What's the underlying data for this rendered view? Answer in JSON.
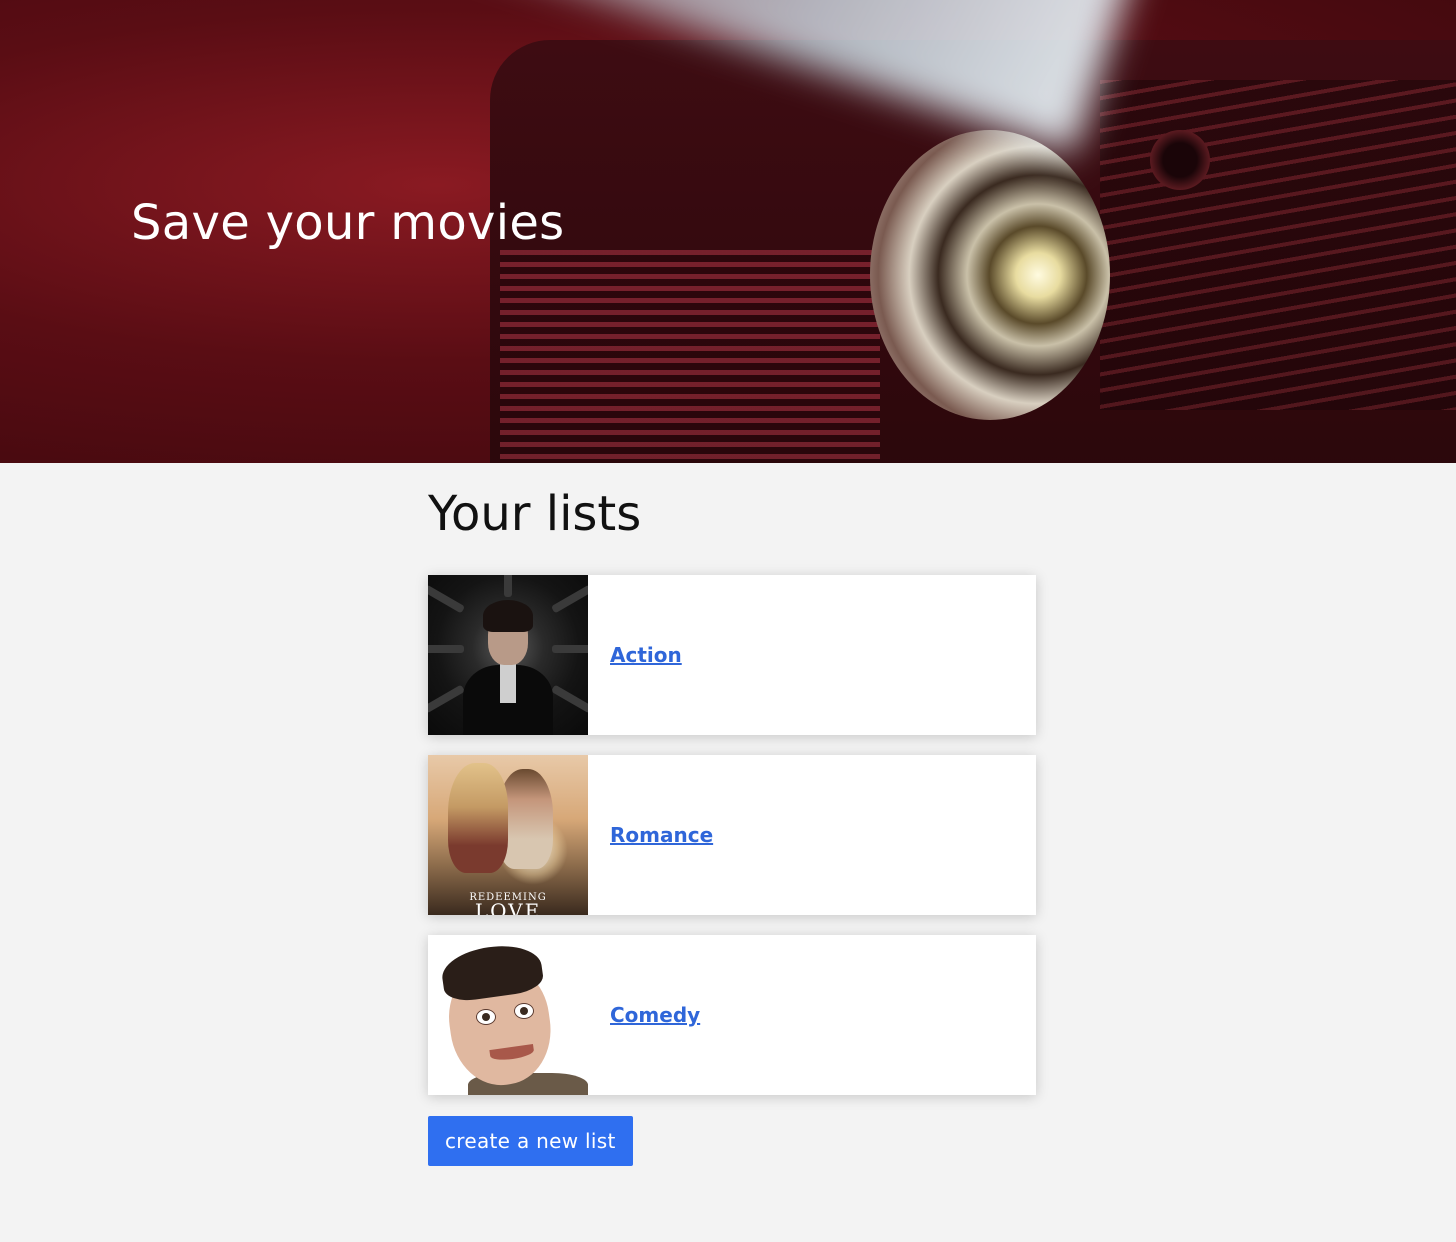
{
  "hero": {
    "title": "Save your movies"
  },
  "lists_section": {
    "title": "Your lists",
    "items": [
      {
        "label": "Action",
        "thumbnail": "action-movie-poster"
      },
      {
        "label": "Romance",
        "thumbnail": "romance-movie-poster",
        "poster_text_small": "REDEEMING",
        "poster_text_large": "LOVE"
      },
      {
        "label": "Comedy",
        "thumbnail": "comedy-actor-photo"
      }
    ]
  },
  "actions": {
    "create_label": "create a new list"
  },
  "colors": {
    "link": "#2f66d9",
    "button": "#2f6ff0",
    "background": "#f3f3f3",
    "hero": "#5a0d14"
  }
}
